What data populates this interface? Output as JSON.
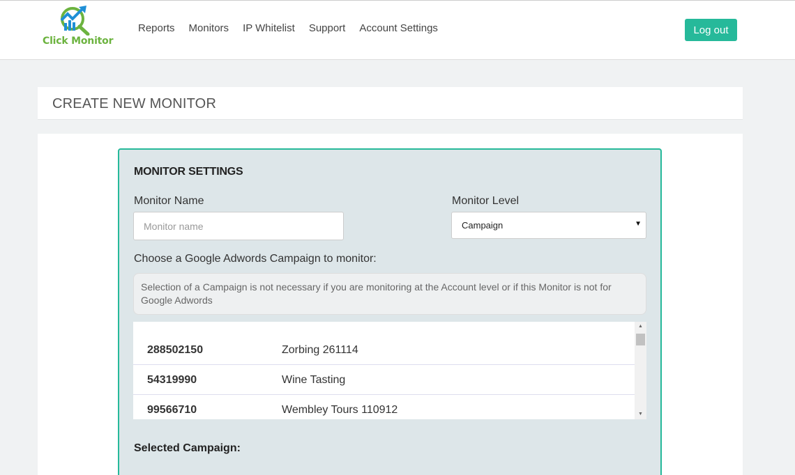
{
  "brand": {
    "name": "Click Monitor",
    "color": "#6cb33f",
    "icon": "chart-magnifier-logo-icon"
  },
  "nav": {
    "items": [
      "Reports",
      "Monitors",
      "IP Whitelist",
      "Support",
      "Account Settings"
    ]
  },
  "header": {
    "logout_label": "Log out",
    "accent": "#26b99a"
  },
  "page": {
    "title": "CREATE NEW MONITOR"
  },
  "settings": {
    "title": "MONITOR SETTINGS",
    "name_label": "Monitor Name",
    "name_placeholder": "Monitor name",
    "name_value": "",
    "level_label": "Monitor Level",
    "level_value": "Campaign",
    "campaign_prompt": "Choose a Google Adwords Campaign to monitor:",
    "campaign_note": "Selection of a Campaign is not necessary if you are monitoring at the Account level or if this Monitor is not for Google Adwords",
    "campaigns": [
      {
        "id": "288502150",
        "name": "Zorbing 261114"
      },
      {
        "id": "54319990",
        "name": "Wine Tasting"
      },
      {
        "id": "99566710",
        "name": "Wembley Tours 110912"
      }
    ],
    "selected_label": "Selected Campaign:"
  }
}
